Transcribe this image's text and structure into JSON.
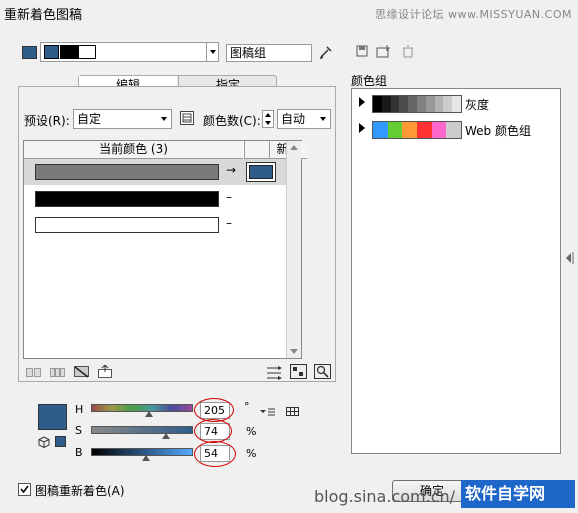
{
  "window": {
    "title": "重新着色图稿",
    "watermark_top": "思缘设计论坛 www.MISSYUAN.COM"
  },
  "top": {
    "group_name_value": "图稿组"
  },
  "tabs": [
    {
      "label": "编辑"
    },
    {
      "label": "指定"
    }
  ],
  "preset": {
    "label": "预设(R):",
    "value": "自定"
  },
  "color_count": {
    "label": "颜色数(C):",
    "value": "自动"
  },
  "table": {
    "col_current": "当前颜色 (3)",
    "col_new": "新建",
    "rows": [
      {
        "current_color": "#7a7a7a",
        "arrow": "→",
        "new_color": "#2e5d8a"
      },
      {
        "current_color": "#000000",
        "arrow": "–",
        "new_color": ""
      },
      {
        "current_color": "#ffffff",
        "arrow": "–",
        "new_color": ""
      }
    ]
  },
  "hsb": {
    "swatch_color": "#2e5d8a",
    "h": {
      "label": "H",
      "value": "205",
      "unit": "°",
      "level": 0.57
    },
    "s": {
      "label": "S",
      "value": "74",
      "unit": "%",
      "level": 0.74
    },
    "b": {
      "label": "B",
      "value": "54",
      "unit": "%",
      "level": 0.54
    }
  },
  "color_groups": {
    "heading": "颜色组",
    "items": [
      {
        "name": "灰度",
        "colors": [
          "#000000",
          "#1a1a1a",
          "#333333",
          "#4d4d4d",
          "#666666",
          "#808080",
          "#999999",
          "#b3b3b3",
          "#cccccc",
          "#e6e6e6"
        ]
      },
      {
        "name": "Web 颜色组",
        "colors": [
          "#3399ff",
          "#66cc33",
          "#ff9933",
          "#ff3333",
          "#ff66cc",
          "#cccccc"
        ]
      }
    ]
  },
  "recolor_checkbox": {
    "label": "图稿重新着色(A)",
    "checked": true
  },
  "buttons": {
    "ok_label": "确定"
  },
  "watermarks": {
    "blog": "blog.sina.com.cn/",
    "logo": "软件自学网"
  },
  "colors": {
    "annotation_red": "#d00000",
    "selected_swatch": "#2e5d8a"
  }
}
